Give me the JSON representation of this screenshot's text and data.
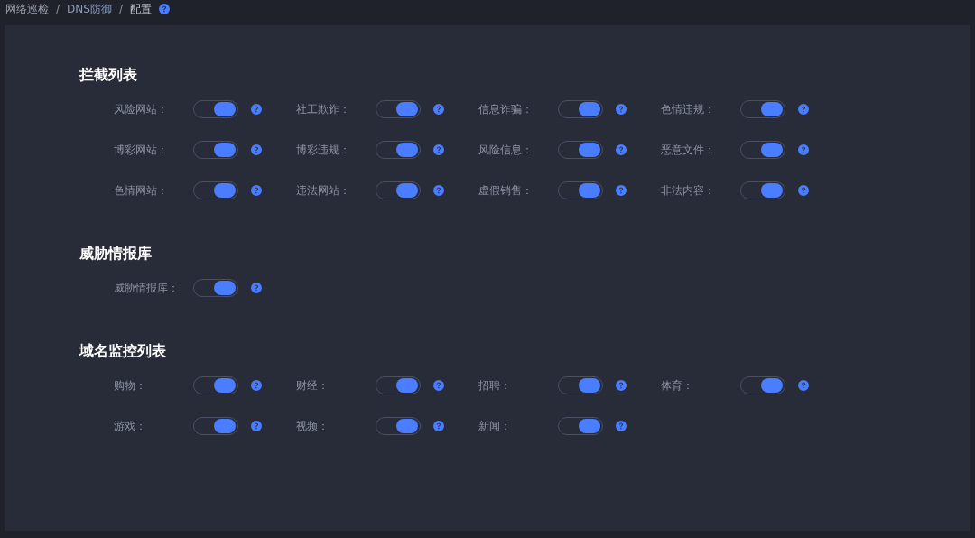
{
  "breadcrumb": [
    "网络巡检",
    "DNS防御",
    "配置"
  ],
  "breadcrumb_separator": "/",
  "sections": [
    {
      "title": "拦截列表",
      "items": [
        {
          "label": "风险网站：",
          "on": true
        },
        {
          "label": "社工欺诈：",
          "on": true
        },
        {
          "label": "信息诈骗：",
          "on": true
        },
        {
          "label": "色情违规：",
          "on": true
        },
        {
          "label": "博彩网站：",
          "on": true
        },
        {
          "label": "博彩违规：",
          "on": true
        },
        {
          "label": "风险信息：",
          "on": true
        },
        {
          "label": "恶意文件：",
          "on": true
        },
        {
          "label": "色情网站：",
          "on": true
        },
        {
          "label": "违法网站：",
          "on": true
        },
        {
          "label": "虚假销售：",
          "on": true
        },
        {
          "label": "非法内容：",
          "on": true
        }
      ]
    },
    {
      "title": "威胁情报库",
      "items": [
        {
          "label": "威胁情报库：",
          "on": true
        }
      ]
    },
    {
      "title": "域名监控列表",
      "items": [
        {
          "label": "购物：",
          "on": true
        },
        {
          "label": "财经：",
          "on": true
        },
        {
          "label": "招聘：",
          "on": true
        },
        {
          "label": "体育：",
          "on": true
        },
        {
          "label": "游戏：",
          "on": true
        },
        {
          "label": "视频：",
          "on": true
        },
        {
          "label": "新闻：",
          "on": true
        }
      ]
    }
  ]
}
